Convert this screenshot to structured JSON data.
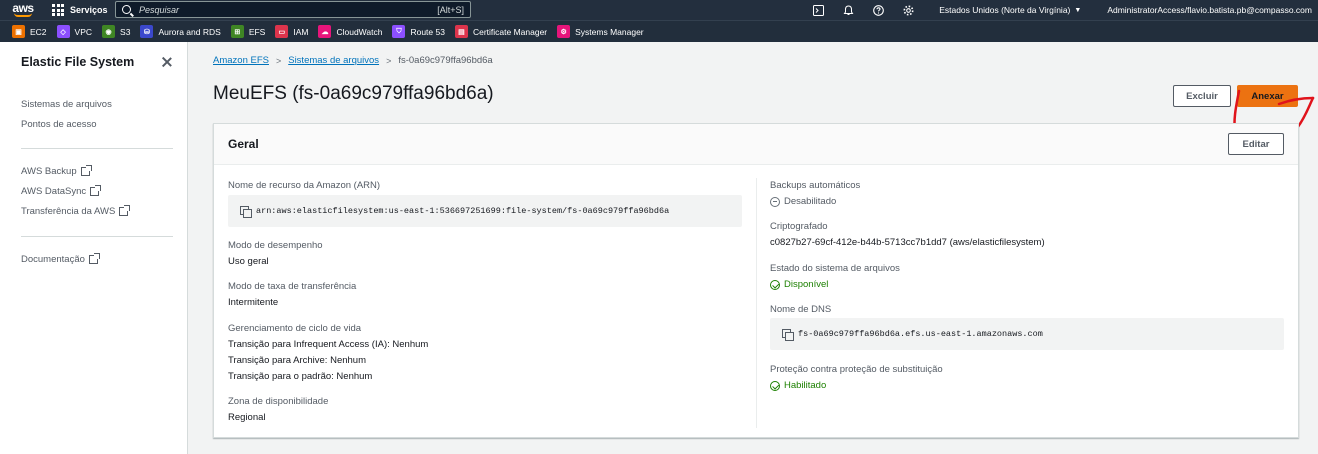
{
  "topnav": {
    "logo_text": "aws",
    "services_label": "Serviços",
    "search_placeholder": "Pesquisar",
    "search_shortcut": "[Alt+S]",
    "region": "Estados Unidos (Norte da Virgínia)",
    "account": "AdministratorAccess/flavio.batista.pb@compasso.com"
  },
  "favorites": [
    {
      "label": "EC2",
      "icon": "ec2-icon",
      "color": "#ed7100"
    },
    {
      "label": "VPC",
      "icon": "vpc-icon",
      "color": "#8c4fff"
    },
    {
      "label": "S3",
      "icon": "s3-icon",
      "color": "#3f8624"
    },
    {
      "label": "Aurora and RDS",
      "icon": "rds-icon",
      "color": "#3b48cc"
    },
    {
      "label": "EFS",
      "icon": "efs-icon",
      "color": "#3f8624"
    },
    {
      "label": "IAM",
      "icon": "iam-icon",
      "color": "#dd344c"
    },
    {
      "label": "CloudWatch",
      "icon": "cloudwatch-icon",
      "color": "#e7157b"
    },
    {
      "label": "Route 53",
      "icon": "route53-icon",
      "color": "#8c4fff"
    },
    {
      "label": "Certificate Manager",
      "icon": "certificate-manager-icon",
      "color": "#dd344c"
    },
    {
      "label": "Systems Manager",
      "icon": "systems-manager-icon",
      "color": "#e7157b"
    }
  ],
  "sidebar": {
    "title": "Elastic File System",
    "items": [
      "Sistemas de arquivos",
      "Pontos de acesso"
    ],
    "external": [
      "AWS Backup",
      "AWS DataSync",
      "Transferência da AWS"
    ],
    "docs": "Documentação"
  },
  "breadcrumb": {
    "root": "Amazon EFS",
    "parent": "Sistemas de arquivos",
    "current": "fs-0a69c979ffa96bd6a"
  },
  "page": {
    "title": "MeuEFS (fs-0a69c979ffa96bd6a)",
    "delete_label": "Excluir",
    "attach_label": "Anexar"
  },
  "panel": {
    "title": "Geral",
    "edit_label": "Editar",
    "left": {
      "arn_label": "Nome de recurso da Amazon (ARN)",
      "arn_value": "arn:aws:elasticfilesystem:us-east-1:536697251699:file-system/fs-0a69c979ffa96bd6a",
      "perf_label": "Modo de desempenho",
      "perf_value": "Uso geral",
      "throughput_label": "Modo de taxa de transferência",
      "throughput_value": "Intermitente",
      "lifecycle_label": "Gerenciamento de ciclo de vida",
      "lifecycle_lines": [
        "Transição para Infrequent Access (IA): Nenhum",
        "Transição para Archive: Nenhum",
        "Transição para o padrão: Nenhum"
      ],
      "az_label": "Zona de disponibilidade",
      "az_value": "Regional"
    },
    "right": {
      "backup_label": "Backups automáticos",
      "backup_value": "Desabilitado",
      "encrypted_label": "Criptografado",
      "encrypted_value": "c0827b27-69cf-412e-b44b-5713cc7b1dd7 (aws/elasticfilesystem)",
      "state_label": "Estado do sistema de arquivos",
      "state_value": "Disponível",
      "dns_label": "Nome de DNS",
      "dns_value": "fs-0a69c979ffa96bd6a.efs.us-east-1.amazonaws.com",
      "protection_label": "Proteção contra proteção de substituição",
      "protection_value": "Habilitado"
    }
  },
  "colors": {
    "nav": "#232f3e",
    "accent": "#ec7211",
    "link": "#0073bb",
    "success": "#1d8102",
    "annotation": "#e0131b"
  }
}
